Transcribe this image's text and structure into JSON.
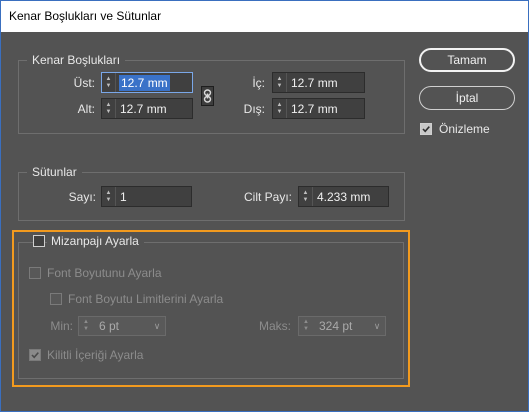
{
  "window": {
    "title": "Kenar Boşlukları ve Sütunlar"
  },
  "margins": {
    "legend": "Kenar Boşlukları",
    "top_label": "Üst:",
    "top_value": "12.7 mm",
    "bottom_label": "Alt:",
    "bottom_value": "12.7 mm",
    "inside_label": "İç:",
    "inside_value": "12.7 mm",
    "outside_label": "Dış:",
    "outside_value": "12.7 mm"
  },
  "columns": {
    "legend": "Sütunlar",
    "count_label": "Sayı:",
    "count_value": "1",
    "gutter_label": "Cilt Payı:",
    "gutter_value": "4.233 mm"
  },
  "buttons": {
    "ok_label": "Tamam",
    "cancel_label": "İptal"
  },
  "preview": {
    "label": "Önizleme",
    "checked": true
  },
  "adjust_layout": {
    "label": "Mizanpajı Ayarla",
    "checked": false,
    "font_size_label": "Font Boyutunu Ayarla",
    "font_limits_label": "Font Boyutu Limitlerini Ayarla",
    "min_label": "Min:",
    "min_value": "6 pt",
    "max_label": "Maks:",
    "max_value": "324 pt",
    "locked_content_label": "Kilitli İçeriği Ayarla"
  },
  "colors": {
    "accent_blue": "#3a72c8",
    "highlight_orange": "#f29a1e",
    "dialog_bg": "#535353"
  },
  "icons": {
    "link": "chain-link-icon",
    "check": "checkmark-icon",
    "spinner": "up-down-spinner-icon",
    "dropdown": "chevron-down-icon"
  }
}
